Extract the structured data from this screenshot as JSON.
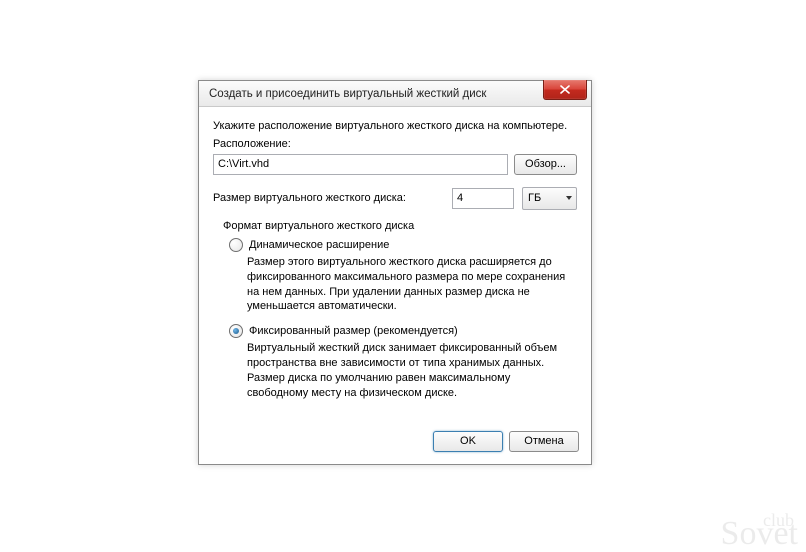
{
  "dialog": {
    "title": "Создать и присоединить виртуальный жесткий диск",
    "instruction": "Укажите расположение виртуального жесткого диска на компьютере.",
    "location_label": "Расположение:",
    "location_value": "C:\\Virt.vhd",
    "browse_label": "Обзор...",
    "size_label": "Размер виртуального жесткого диска:",
    "size_value": "4",
    "size_unit": "ГБ",
    "format_group_title": "Формат виртуального жесткого диска",
    "radio_dynamic": {
      "label": "Динамическое расширение",
      "description": "Размер этого виртуального жесткого диска расширяется до фиксированного максимального размера по мере сохранения на нем данных. При удалении данных размер диска не уменьшается автоматически.",
      "checked": false
    },
    "radio_fixed": {
      "label": "Фиксированный размер (рекомендуется)",
      "description": "Виртуальный жесткий диск занимает фиксированный объем пространства вне зависимости от типа хранимых данных. Размер диска по умолчанию равен максимальному свободному месту на физическом диске.",
      "checked": true
    },
    "ok_label": "OK",
    "cancel_label": "Отмена"
  },
  "watermark": {
    "line1": "club",
    "line2": "Sovet"
  }
}
